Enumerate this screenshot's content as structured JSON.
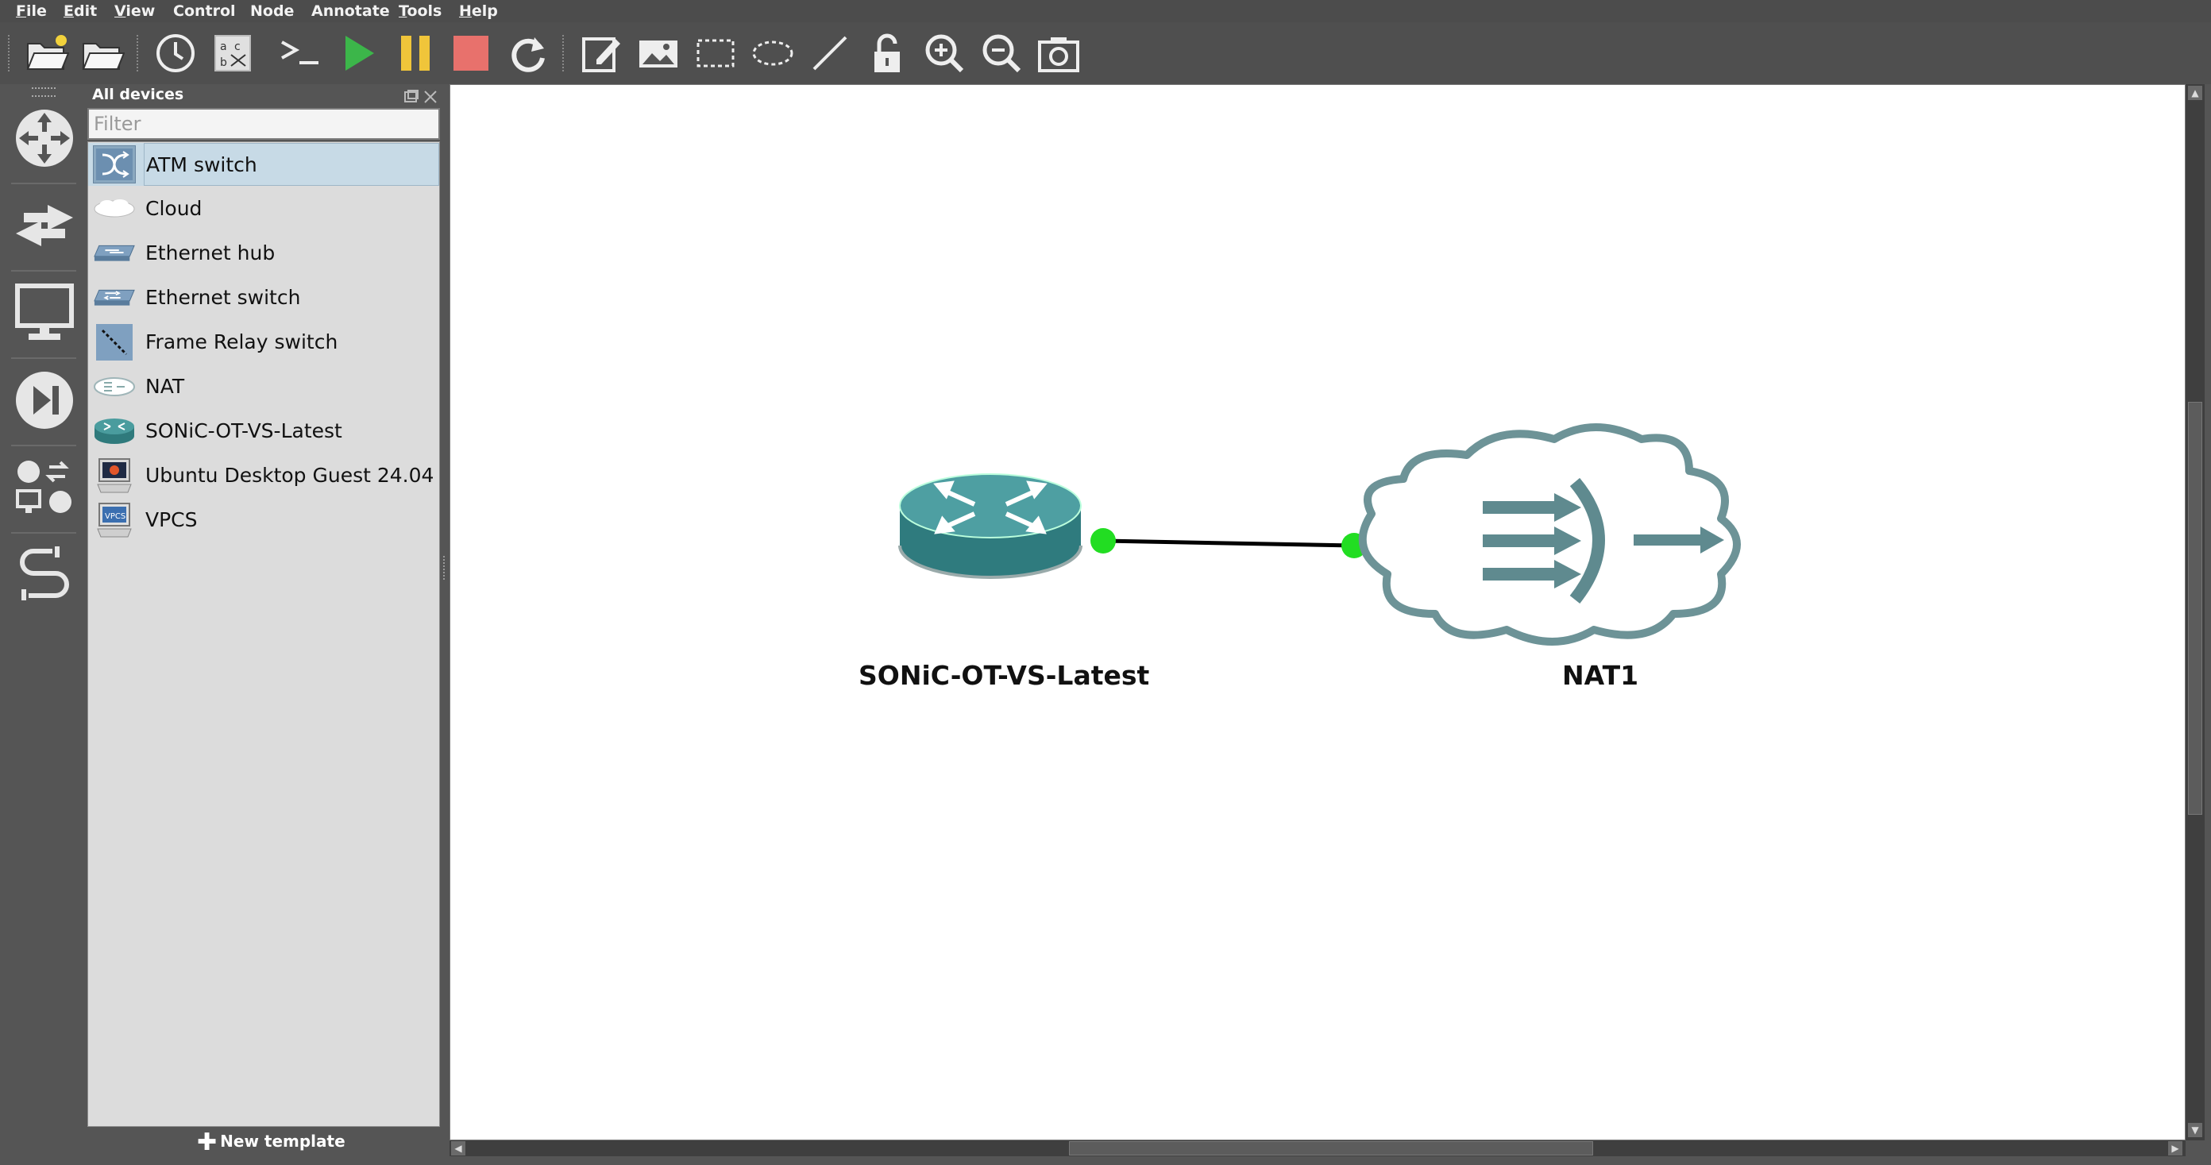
{
  "menu": {
    "items": [
      {
        "label": "File",
        "key": "F",
        "rest": "ile"
      },
      {
        "label": "Edit",
        "key": "E",
        "rest": "dit"
      },
      {
        "label": "View",
        "key": "V",
        "rest": "iew"
      },
      {
        "label": "Control",
        "key": "",
        "rest": "Control"
      },
      {
        "label": "Node",
        "key": "",
        "rest": "Node"
      },
      {
        "label": "Annotate",
        "key": "",
        "rest": "Annotate"
      },
      {
        "label": "Tools",
        "key": "T",
        "rest": "ools"
      },
      {
        "label": "Help",
        "key": "H",
        "rest": "elp"
      }
    ]
  },
  "toolbar": {
    "buttons": [
      "new-project",
      "open-project",
      "snapshot",
      "show-interface-labels",
      "console-all",
      "start-all",
      "suspend-all",
      "stop-all",
      "reload-all",
      "add-note",
      "insert-picture",
      "draw-rectangle",
      "draw-ellipse",
      "draw-line",
      "lock-unlock",
      "zoom-in",
      "zoom-out",
      "screenshot"
    ],
    "colors": {
      "start": "#3cb64a",
      "suspend": "#f0c53a",
      "stop": "#e8716c"
    }
  },
  "devices_panel": {
    "title": "All devices",
    "filter_placeholder": "Filter",
    "items": [
      {
        "label": "ATM switch",
        "icon": "atm-switch-icon",
        "selected": true
      },
      {
        "label": "Cloud",
        "icon": "cloud-icon",
        "selected": false
      },
      {
        "label": "Ethernet hub",
        "icon": "ethernet-hub-icon",
        "selected": false
      },
      {
        "label": "Ethernet switch",
        "icon": "ethernet-switch-icon",
        "selected": false
      },
      {
        "label": "Frame Relay switch",
        "icon": "frame-relay-switch-icon",
        "selected": false
      },
      {
        "label": "NAT",
        "icon": "nat-icon",
        "selected": false
      },
      {
        "label": "SONiC-OT-VS-Latest",
        "icon": "router-icon",
        "selected": false
      },
      {
        "label": "Ubuntu Desktop Guest 24.04",
        "icon": "ubuntu-desktop-icon",
        "selected": false
      },
      {
        "label": "VPCS",
        "icon": "vpcs-icon",
        "selected": false
      }
    ],
    "new_template": "New template"
  },
  "topology": {
    "nodes": [
      {
        "name": "SONiC-OT-VS-Latest",
        "type": "router",
        "color": "#3b8a8c"
      },
      {
        "name": "NAT1",
        "type": "nat",
        "color": "#5f8a8f"
      }
    ],
    "link_status_color": "#22dd22"
  }
}
